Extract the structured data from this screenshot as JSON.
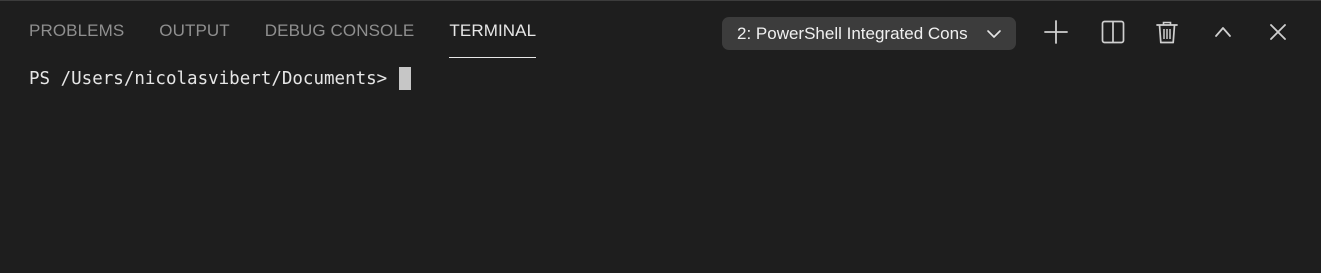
{
  "tabs": [
    {
      "label": "PROBLEMS",
      "active": false
    },
    {
      "label": "OUTPUT",
      "active": false
    },
    {
      "label": "DEBUG CONSOLE",
      "active": false
    },
    {
      "label": "TERMINAL",
      "active": true
    }
  ],
  "terminal_selector": {
    "selected": "2: PowerShell Integrated Cons",
    "icon": "chevron-down-icon"
  },
  "actions": [
    {
      "name": "new-terminal",
      "icon": "plus-icon"
    },
    {
      "name": "split-terminal",
      "icon": "split-icon"
    },
    {
      "name": "kill-terminal",
      "icon": "trash-icon"
    },
    {
      "name": "maximize-panel",
      "icon": "chevron-up-icon"
    },
    {
      "name": "close-panel",
      "icon": "close-icon"
    }
  ],
  "terminal": {
    "prompt": "PS /Users/nicolasvibert/Documents>"
  },
  "colors": {
    "background": "#1e1e1e",
    "active_tab": "#e7e7e7",
    "inactive_tab": "#8f8f8f",
    "dropdown_bg": "#3c3c3c",
    "cursor": "#c6c6c6"
  }
}
